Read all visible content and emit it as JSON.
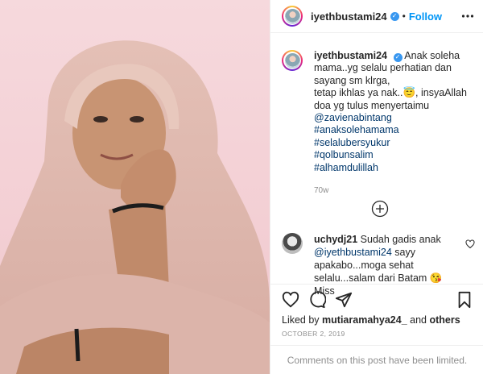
{
  "post": {
    "username": "iyethbustami24",
    "separator": "•",
    "follow_label": "Follow",
    "verified_mark": "✓",
    "icons": {
      "more": "more-options-icon",
      "verified": "verified-badge-icon",
      "load_more": "load-more-comments-icon",
      "like": "heart-icon",
      "comment": "comment-icon",
      "share": "paper-plane-icon",
      "save": "bookmark-icon"
    },
    "colors": {
      "link": "#00376b",
      "follow": "#0095f6",
      "verified": "#3897f0",
      "muted": "#8e8e8e"
    }
  },
  "caption": {
    "username": "iyethbustami24",
    "lines": [
      "Anak soleha mama..yg selalu perhatian dan sayang sm klrga,",
      "tetap ikhlas ya nak..😇, insyaAllah doa yg tulus menyertaimu"
    ],
    "tags": [
      "@zavienabintang",
      "#anaksolehamama",
      "#selalubersyukur",
      "#qolbunsalim",
      "#alhamdulillah"
    ],
    "time": "70w"
  },
  "comment": {
    "username": "uchydj21",
    "text_before": "Sudah gadis anak",
    "mention": "@iyethbustami24",
    "text_after": "sayy apakabo...moga sehat selalu...salam dari Batam 😘Miss"
  },
  "likes": {
    "prefix": "Liked by",
    "user": "mutiaramahya24_",
    "middle": "and",
    "others": "others"
  },
  "date": "OCTOBER 2, 2019",
  "notice": "Comments on this post have been limited."
}
